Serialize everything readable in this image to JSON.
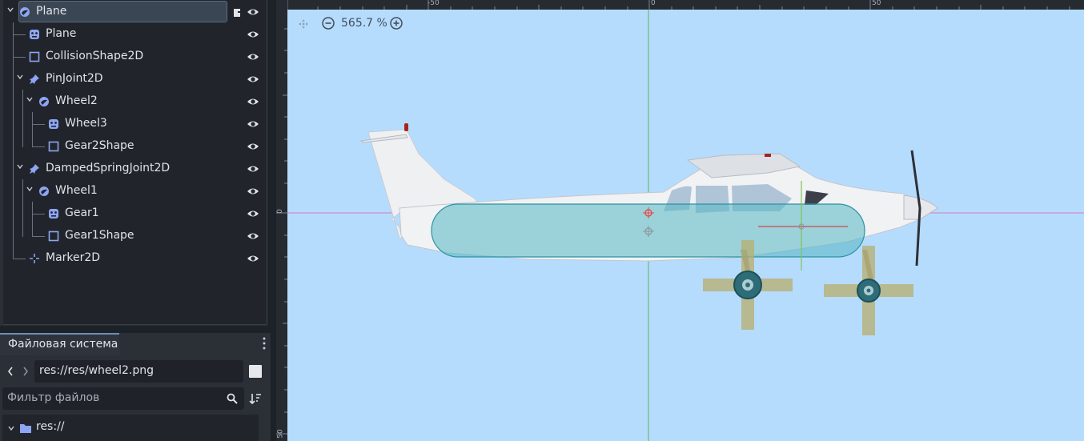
{
  "scene_tree": {
    "nodes": [
      {
        "label": "Plane",
        "icon": "rigidbody-icon",
        "depth": 0,
        "selected": true
      },
      {
        "label": "Plane",
        "icon": "sprite-icon",
        "depth": 1
      },
      {
        "label": "CollisionShape2D",
        "icon": "collision-shape-icon",
        "depth": 1
      },
      {
        "label": "PinJoint2D",
        "icon": "pin-joint-icon",
        "depth": 1
      },
      {
        "label": "Wheel2",
        "icon": "rigidbody-icon",
        "depth": 2
      },
      {
        "label": "Wheel3",
        "icon": "sprite-icon",
        "depth": 3
      },
      {
        "label": "Gear2Shape",
        "icon": "collision-shape-icon",
        "depth": 3
      },
      {
        "label": "DampedSpringJoint2D",
        "icon": "pin-joint-icon",
        "depth": 1
      },
      {
        "label": "Wheel1",
        "icon": "rigidbody-icon",
        "depth": 2
      },
      {
        "label": "Gear1",
        "icon": "sprite-icon",
        "depth": 3
      },
      {
        "label": "Gear1Shape",
        "icon": "collision-shape-icon",
        "depth": 3
      },
      {
        "label": "Marker2D",
        "icon": "marker-icon",
        "depth": 1
      }
    ]
  },
  "filesystem": {
    "tab_label": "Файловая система",
    "path": "res://res/wheel2.png",
    "filter_placeholder": "Фильтр файлов",
    "root_label": "res://"
  },
  "viewport": {
    "zoom_label": "565.7 %",
    "ruler_top": [
      "-50",
      "0",
      "50"
    ],
    "ruler_left": [
      "0",
      "50"
    ],
    "bg_color": "#b6dcfd"
  }
}
